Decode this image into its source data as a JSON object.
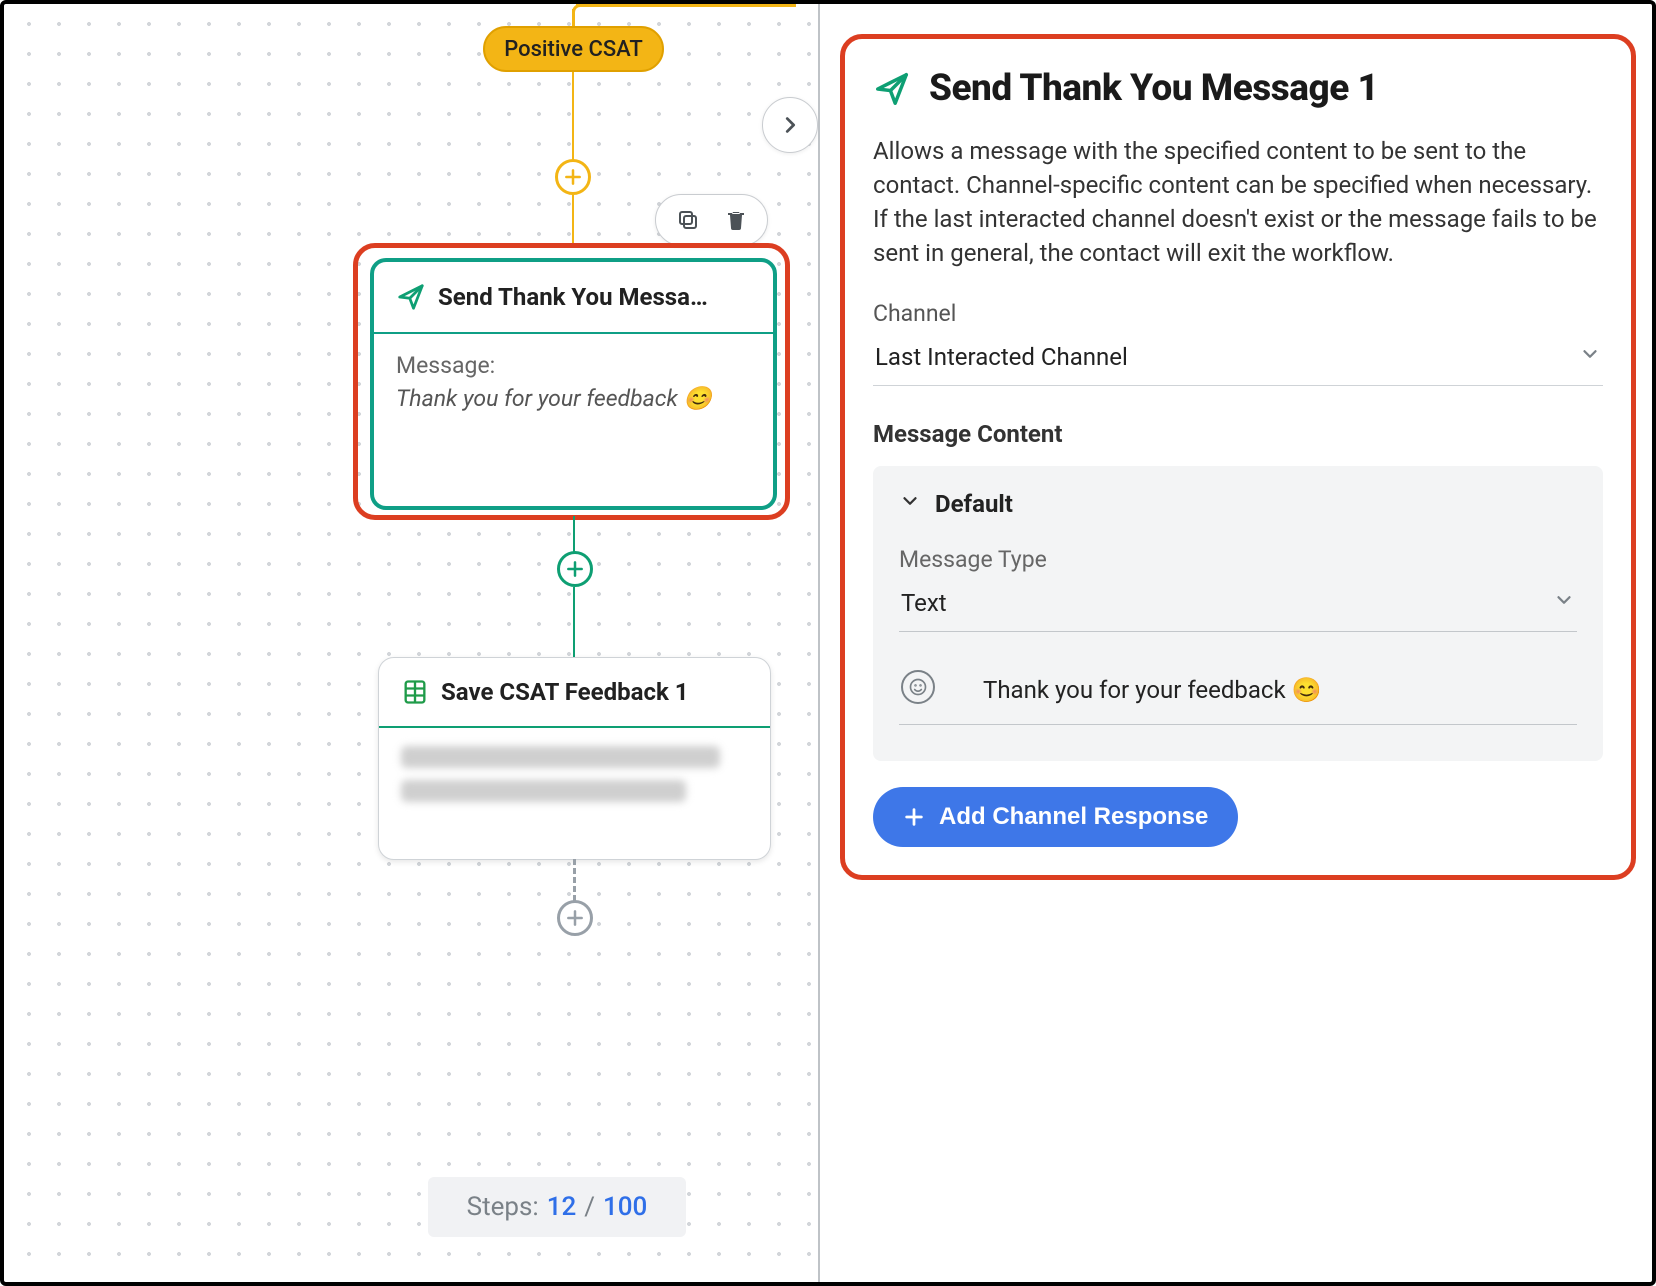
{
  "canvas": {
    "branch_label": "Positive CSAT",
    "node_selected": {
      "title": "Send Thank You Messa…",
      "message_label": "Message:",
      "message_text": "Thank you for your feedback 😊"
    },
    "node2": {
      "title": "Save CSAT Feedback 1"
    },
    "steps": {
      "label": "Steps:",
      "current": "12",
      "sep": "/",
      "max": "100"
    }
  },
  "panel": {
    "title": "Send Thank You Message 1",
    "description": "Allows a message with the specified content to be sent to the contact. Channel-specific content can be specified when necessary. If the last interacted channel doesn't exist or the message fails to be sent in general, the contact will exit the workflow.",
    "channel": {
      "label": "Channel",
      "value": "Last Interacted Channel"
    },
    "message_content_label": "Message Content",
    "default_block": {
      "header": "Default",
      "message_type_label": "Message Type",
      "message_type_value": "Text",
      "message_value": "Thank you for your feedback 😊"
    },
    "add_channel_label": "Add Channel Response"
  }
}
